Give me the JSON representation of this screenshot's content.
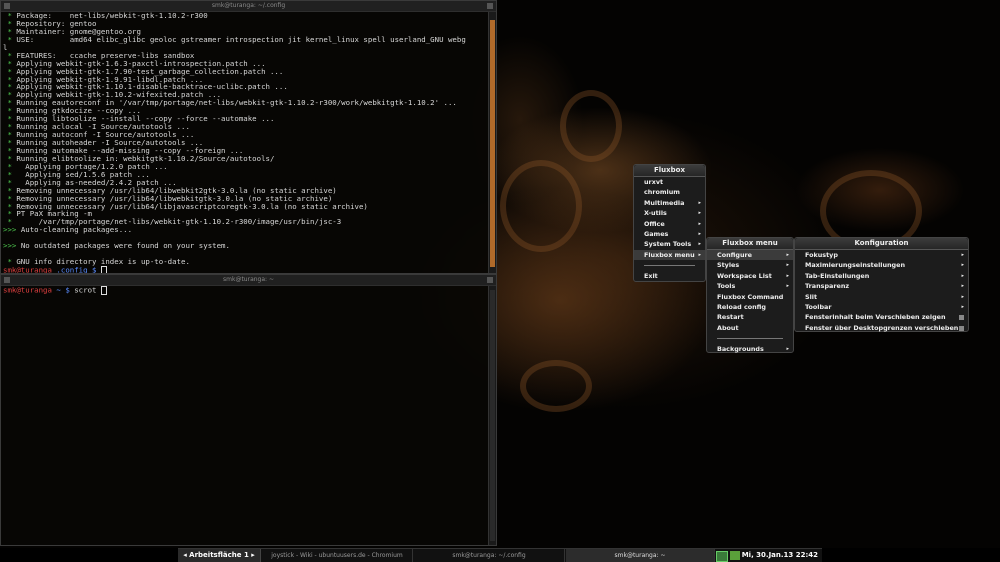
{
  "top_terminal": {
    "title": "smk@turanga: ~/.config",
    "lines": [
      {
        "segs": [
          {
            "c": "g",
            "t": " * "
          },
          {
            "c": "",
            "t": "Package:    net-libs/webkit-gtk-1.10.2-r300"
          }
        ]
      },
      {
        "segs": [
          {
            "c": "g",
            "t": " * "
          },
          {
            "c": "",
            "t": "Repository: gentoo"
          }
        ]
      },
      {
        "segs": [
          {
            "c": "g",
            "t": " * "
          },
          {
            "c": "",
            "t": "Maintainer: gnome@gentoo.org"
          }
        ]
      },
      {
        "segs": [
          {
            "c": "g",
            "t": " * "
          },
          {
            "c": "",
            "t": "USE:        amd64 elibc_glibc geoloc gstreamer introspection jit kernel_linux spell userland_GNU webg"
          }
        ]
      },
      {
        "segs": [
          {
            "c": "",
            "t": "l"
          }
        ]
      },
      {
        "segs": [
          {
            "c": "g",
            "t": " * "
          },
          {
            "c": "",
            "t": "FEATURES:   ccache preserve-libs sandbox"
          }
        ]
      },
      {
        "segs": [
          {
            "c": "g",
            "t": " * "
          },
          {
            "c": "",
            "t": "Applying webkit-gtk-1.6.3-paxctl-introspection.patch ..."
          }
        ]
      },
      {
        "segs": [
          {
            "c": "g",
            "t": " * "
          },
          {
            "c": "",
            "t": "Applying webkit-gtk-1.7.90-test_garbage_collection.patch ..."
          }
        ]
      },
      {
        "segs": [
          {
            "c": "g",
            "t": " * "
          },
          {
            "c": "",
            "t": "Applying webkit-gtk-1.9.91-libdl.patch ..."
          }
        ]
      },
      {
        "segs": [
          {
            "c": "g",
            "t": " * "
          },
          {
            "c": "",
            "t": "Applying webkit-gtk-1.10.1-disable-backtrace-uclibc.patch ..."
          }
        ]
      },
      {
        "segs": [
          {
            "c": "g",
            "t": " * "
          },
          {
            "c": "",
            "t": "Applying webkit-gtk-1.10.2-wifexited.patch ..."
          }
        ]
      },
      {
        "segs": [
          {
            "c": "g",
            "t": " * "
          },
          {
            "c": "",
            "t": "Running eautoreconf in '/var/tmp/portage/net-libs/webkit-gtk-1.10.2-r300/work/webkitgtk-1.10.2' ..."
          }
        ]
      },
      {
        "segs": [
          {
            "c": "g",
            "t": " * "
          },
          {
            "c": "",
            "t": "Running gtkdocize --copy ..."
          }
        ]
      },
      {
        "segs": [
          {
            "c": "g",
            "t": " * "
          },
          {
            "c": "",
            "t": "Running libtoolize --install --copy --force --automake ..."
          }
        ]
      },
      {
        "segs": [
          {
            "c": "g",
            "t": " * "
          },
          {
            "c": "",
            "t": "Running aclocal -I Source/autotools ..."
          }
        ]
      },
      {
        "segs": [
          {
            "c": "g",
            "t": " * "
          },
          {
            "c": "",
            "t": "Running autoconf -I Source/autotools ..."
          }
        ]
      },
      {
        "segs": [
          {
            "c": "g",
            "t": " * "
          },
          {
            "c": "",
            "t": "Running autoheader -I Source/autotools ..."
          }
        ]
      },
      {
        "segs": [
          {
            "c": "g",
            "t": " * "
          },
          {
            "c": "",
            "t": "Running automake --add-missing --copy --foreign ..."
          }
        ]
      },
      {
        "segs": [
          {
            "c": "g",
            "t": " * "
          },
          {
            "c": "",
            "t": "Running elibtoolize in: webkitgtk-1.10.2/Source/autotools/"
          }
        ]
      },
      {
        "segs": [
          {
            "c": "g",
            "t": " *   "
          },
          {
            "c": "",
            "t": "Applying portage/1.2.0 patch ..."
          }
        ]
      },
      {
        "segs": [
          {
            "c": "g",
            "t": " *   "
          },
          {
            "c": "",
            "t": "Applying sed/1.5.6 patch ..."
          }
        ]
      },
      {
        "segs": [
          {
            "c": "g",
            "t": " *   "
          },
          {
            "c": "",
            "t": "Applying as-needed/2.4.2 patch ..."
          }
        ]
      },
      {
        "segs": [
          {
            "c": "g",
            "t": " * "
          },
          {
            "c": "",
            "t": "Removing unnecessary /usr/lib64/libwebkit2gtk-3.0.la (no static archive)"
          }
        ]
      },
      {
        "segs": [
          {
            "c": "g",
            "t": " * "
          },
          {
            "c": "",
            "t": "Removing unnecessary /usr/lib64/libwebkitgtk-3.0.la (no static archive)"
          }
        ]
      },
      {
        "segs": [
          {
            "c": "g",
            "t": " * "
          },
          {
            "c": "",
            "t": "Removing unnecessary /usr/lib64/libjavascriptcoregtk-3.0.la (no static archive)"
          }
        ]
      },
      {
        "segs": [
          {
            "c": "g",
            "t": " * "
          },
          {
            "c": "",
            "t": "PT PaX marking -m"
          }
        ]
      },
      {
        "segs": [
          {
            "c": "g",
            "t": " * "
          },
          {
            "c": "",
            "t": "     /var/tmp/portage/net-libs/webkit-gtk-1.10.2-r300/image/usr/bin/jsc-3"
          }
        ]
      },
      {
        "segs": [
          {
            "c": "g",
            "t": ">>> "
          },
          {
            "c": "",
            "t": "Auto-cleaning packages..."
          }
        ]
      },
      {
        "segs": [
          {
            "c": "",
            "t": ""
          }
        ]
      },
      {
        "segs": [
          {
            "c": "g",
            "t": ">>> "
          },
          {
            "c": "",
            "t": "No outdated packages were found on your system."
          }
        ]
      },
      {
        "segs": [
          {
            "c": "",
            "t": ""
          }
        ]
      },
      {
        "segs": [
          {
            "c": "g",
            "t": " * "
          },
          {
            "c": "",
            "t": "GNU info directory index is up-to-date."
          }
        ]
      },
      {
        "segs": [
          {
            "c": "r",
            "t": "smk"
          },
          {
            "c": "r",
            "t": "@turanga"
          },
          {
            "c": "b",
            "t": " .config $ "
          }
        ]
      }
    ]
  },
  "bottom_terminal": {
    "title": "smk@turanga: ~",
    "lines": [
      {
        "segs": [
          {
            "c": "r",
            "t": "smk"
          },
          {
            "c": "r",
            "t": "@turanga"
          },
          {
            "c": "b",
            "t": " ~ $ "
          },
          {
            "c": "",
            "t": "scrot "
          }
        ]
      }
    ]
  },
  "menus": {
    "root": {
      "title": "Fluxbox",
      "items": [
        {
          "label": "urxvt",
          "arrow": ""
        },
        {
          "label": "chromium",
          "arrow": ""
        },
        {
          "label": "Multimedia",
          "arrow": "▸"
        },
        {
          "label": "X-utils",
          "arrow": "▸"
        },
        {
          "label": "Office",
          "arrow": "▸"
        },
        {
          "label": "Games",
          "arrow": "▸"
        },
        {
          "label": "System Tools",
          "arrow": "▸"
        },
        {
          "label": "Fluxbox menu",
          "arrow": "▸",
          "selected": true
        },
        {
          "sep": true
        },
        {
          "label": "Exit",
          "arrow": ""
        }
      ]
    },
    "fluxbox_menu": {
      "title": "Fluxbox menu",
      "items": [
        {
          "label": "Configure",
          "arrow": "▸",
          "selected": true
        },
        {
          "label": "Styles",
          "arrow": "▸"
        },
        {
          "label": "Workspace List",
          "arrow": "▸"
        },
        {
          "label": "Tools",
          "arrow": "▸"
        },
        {
          "label": "Fluxbox Command",
          "arrow": ""
        },
        {
          "label": "Reload config",
          "arrow": ""
        },
        {
          "label": "Restart",
          "arrow": ""
        },
        {
          "label": "About",
          "arrow": ""
        },
        {
          "sep": true
        },
        {
          "label": "Backgrounds",
          "arrow": "▸"
        }
      ]
    },
    "konfiguration": {
      "title": "Konfiguration",
      "items": [
        {
          "label": "Fokustyp",
          "arrow": "▸"
        },
        {
          "label": "Maximierungseinstellungen",
          "arrow": "▸"
        },
        {
          "label": "Tab-Einstellungen",
          "arrow": "▸"
        },
        {
          "label": "Transparenz",
          "arrow": "▸"
        },
        {
          "label": "Slit",
          "arrow": "▸"
        },
        {
          "label": "Toolbar",
          "arrow": "▸"
        },
        {
          "label": "Fensterinhalt beim Verschieben zeigen",
          "check": true
        },
        {
          "label": "Fenster über Desktopgrenzen verschieben",
          "check": true
        }
      ]
    }
  },
  "taskbar": {
    "workspace": "Arbeitsfläche 1",
    "prev_icon": "◂",
    "next_icon": "▸",
    "tasks": [
      {
        "label": "joystick - Wiki - ubuntuusers.de - Chromium"
      },
      {
        "label": "smk@turanga: ~/.config"
      },
      {
        "label": "smk@turanga: ~"
      }
    ],
    "clock": "Mi, 30.Jan.13  22:42"
  }
}
